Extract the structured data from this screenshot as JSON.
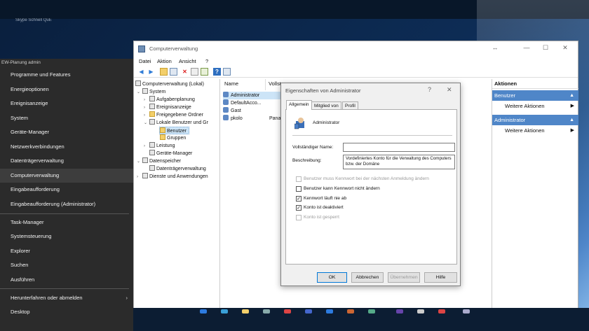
{
  "desktop": {
    "text": "Skype     Schnell QuE"
  },
  "winx_menu": {
    "caption": "EW-Planung admin",
    "items": [
      {
        "label": "Programme und Features"
      },
      {
        "label": "Energieoptionen"
      },
      {
        "label": "Ereignisanzeige"
      },
      {
        "label": "System"
      },
      {
        "label": "Geräte-Manager"
      },
      {
        "label": "Netzwerkverbindungen"
      },
      {
        "label": "Datenträgerverwaltung"
      },
      {
        "label": "Computerverwaltung"
      },
      {
        "label": "Eingabeaufforderung"
      },
      {
        "label": "Eingabeaufforderung (Administrator)"
      },
      {
        "label": "Task-Manager"
      },
      {
        "label": "Systemsteuerung"
      },
      {
        "label": "Explorer"
      },
      {
        "label": "Suchen"
      },
      {
        "label": "Ausführen"
      },
      {
        "label": "Herunterfahren oder abmelden"
      },
      {
        "label": "Desktop"
      }
    ],
    "submenu_arrow": "›"
  },
  "window": {
    "title": "Computerverwaltung",
    "controls": {
      "resize": "↔",
      "minimize": "—",
      "maximize": "☐",
      "close": "✕"
    },
    "menu": [
      "Datei",
      "Aktion",
      "Ansicht",
      "?"
    ],
    "toolbar_icons": [
      "back-arrow-icon",
      "forward-arrow-icon",
      "folder-up-icon",
      "properties-icon",
      "delete-icon",
      "refresh-icon",
      "export-icon",
      "help-icon",
      "view-icon"
    ]
  },
  "tree": [
    {
      "label": "Computerverwaltung (Lokal)",
      "toggle": ""
    },
    {
      "label": "System",
      "toggle": "⌄"
    },
    {
      "label": "Aufgabenplanung",
      "toggle": "›"
    },
    {
      "label": "Ereignisanzeige",
      "toggle": "›"
    },
    {
      "label": "Freigegebene Ordner",
      "toggle": "›"
    },
    {
      "label": "Lokale Benutzer und Gr",
      "toggle": "⌄"
    },
    {
      "label": "Benutzer",
      "toggle": ""
    },
    {
      "label": "Gruppen",
      "toggle": ""
    },
    {
      "label": "Leistung",
      "toggle": "›"
    },
    {
      "label": "Geräte-Manager",
      "toggle": ""
    },
    {
      "label": "Datenspeicher",
      "toggle": "⌄"
    },
    {
      "label": "Datenträgerverwaltung",
      "toggle": ""
    },
    {
      "label": "Dienste und Anwendungen",
      "toggle": "›"
    }
  ],
  "list": {
    "columns": [
      "Name",
      "Vollst"
    ],
    "rows": [
      {
        "name": "Administrator",
        "full": ""
      },
      {
        "name": "DefaultAcco...",
        "full": ""
      },
      {
        "name": "Gast",
        "full": ""
      },
      {
        "name": "pkolo",
        "full": "Pana"
      }
    ]
  },
  "actions": {
    "header": "Aktionen",
    "sections": [
      {
        "title": "Benutzer",
        "item": "Weitere Aktionen"
      },
      {
        "title": "Administrator",
        "item": "Weitere Aktionen"
      }
    ],
    "collapse_glyph": "▲",
    "more_glyph": "▶"
  },
  "dialog": {
    "title": "Eigenschaften von Administrator",
    "help": "?",
    "close": "✕",
    "tabs": [
      "Allgemein",
      "Mitglied von",
      "Profil"
    ],
    "user_name": "Administrator",
    "full_name_label": "Vollständiger Name:",
    "full_name_value": "",
    "description_label": "Beschreibung:",
    "description_value": "Vordefiniertes Konto für die Verwaltung des Computers bzw. der Domäne",
    "checkboxes": [
      {
        "label": "Benutzer muss Kennwort bei der nächsten Anmeldung ändern",
        "checked": false,
        "enabled": false
      },
      {
        "label": "Benutzer kann Kennwort nicht ändern",
        "checked": false,
        "enabled": true
      },
      {
        "label": "Kennwort läuft nie ab",
        "checked": true,
        "enabled": true
      },
      {
        "label": "Konto ist deaktiviert",
        "checked": true,
        "enabled": true
      },
      {
        "label": "Konto ist gesperrt",
        "checked": false,
        "enabled": false
      }
    ],
    "buttons": {
      "ok": "OK",
      "cancel": "Abbrechen",
      "apply": "Übernehmen",
      "help": "Hilfe"
    }
  },
  "colors": {
    "accent": "#0078d7",
    "selection": "#cce4f7",
    "action_section": "#4f86c8",
    "menu_bg": "#2b2b2b"
  }
}
